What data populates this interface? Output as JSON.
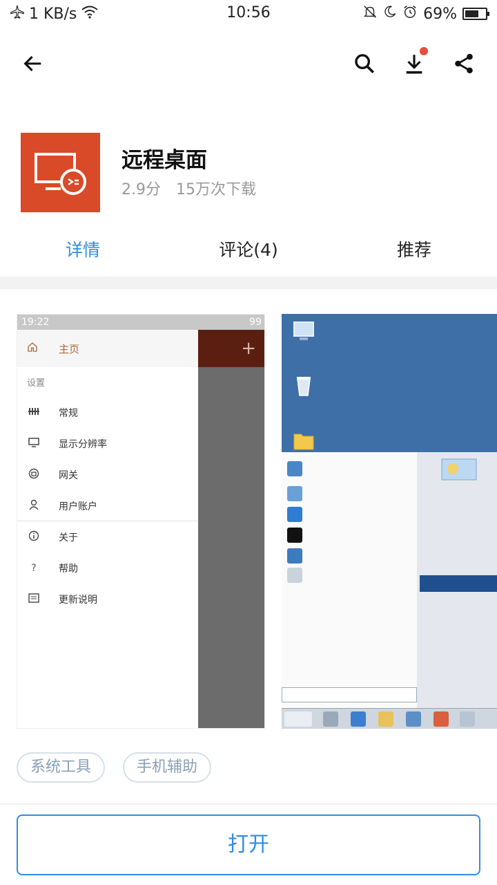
{
  "status_bar": {
    "speed": "1 KB/s",
    "time": "10:56",
    "battery": "69%",
    "battery_level": 0.69
  },
  "toolbar": {
    "back_icon": "arrow-left-icon",
    "search_icon": "search-icon",
    "download_icon": "download-icon",
    "share_icon": "share-icon",
    "download_badge_color": "#e74c3c"
  },
  "app": {
    "name": "远程桌面",
    "rating": "2.9分",
    "downloads": "15万次下载",
    "icon_color": "#d84a28"
  },
  "tabs": [
    {
      "label": "详情",
      "active": true
    },
    {
      "label": "评论(4)",
      "active": false
    },
    {
      "label": "推荐",
      "active": false
    }
  ],
  "accent_color": "#2f8de4",
  "screenshot1": {
    "status_time": "19:22",
    "status_battery": "99",
    "home_label": "主页",
    "plus": "+",
    "section_label": "设置",
    "menu_items": [
      {
        "label": "常规"
      },
      {
        "label": "显示分辨率"
      },
      {
        "label": "网关"
      },
      {
        "label": "用户账户"
      },
      {
        "label": "关于"
      },
      {
        "label": "帮助"
      },
      {
        "label": "更新说明"
      }
    ]
  },
  "tags": [
    {
      "label": "系统工具"
    },
    {
      "label": "手机辅助"
    }
  ],
  "open_button": "打开"
}
